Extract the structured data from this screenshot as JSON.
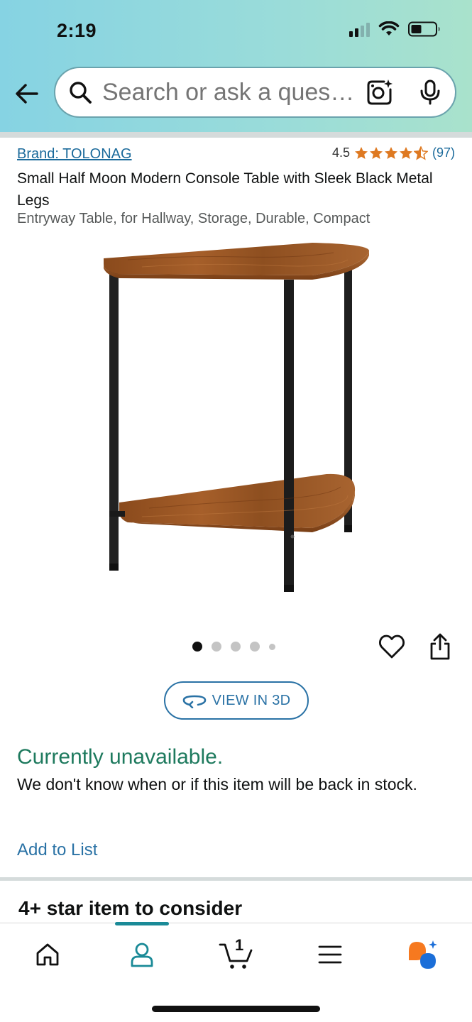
{
  "status_bar": {
    "time": "2:19"
  },
  "search": {
    "placeholder": "Search or ask a question"
  },
  "product": {
    "brand": "Brand: TOLONAG",
    "rating_value": "4.5",
    "rating_stars": 4.5,
    "rating_count": "(97)",
    "title": "Small Half Moon Modern Console Table with Sleek Black Metal Legs",
    "subtitle": "Entryway Table, for Hallway, Storage, Durable, Compact",
    "image_count": 5,
    "active_image_index": 0
  },
  "actions": {
    "view_3d_label": "VIEW IN 3D"
  },
  "availability": {
    "status": "Currently unavailable.",
    "description": "We don't know when or if this item will be back in stock."
  },
  "add_to_list_label": "Add to List",
  "recommendations": {
    "title": "4+ star item to consider"
  },
  "bottom_nav": {
    "active_tab": "account",
    "cart_count": "1",
    "items": [
      "home-icon",
      "account-icon",
      "cart-icon",
      "menu-icon",
      "rufus-icon"
    ]
  },
  "colors": {
    "header_gradient_start": "#86d3e3",
    "header_gradient_end": "#a9e2cc",
    "link": "#1b6a9b",
    "star": "#de7921",
    "unavailable": "#1e7a5e",
    "nav_active": "#1a8a97"
  }
}
